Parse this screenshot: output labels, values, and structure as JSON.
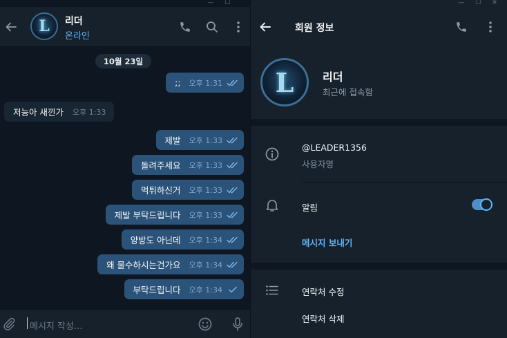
{
  "chat": {
    "peer_name": "리더",
    "peer_status": "온라인",
    "date_chip": "10월 23일",
    "messages": [
      {
        "text": ";;",
        "time": "오후 1:31",
        "dir": "out"
      },
      {
        "text": "저능아 새낀가",
        "time": "오후 1:33",
        "dir": "in"
      },
      {
        "text": "제발",
        "time": "오후 1:33",
        "dir": "out"
      },
      {
        "text": "돌려주세요",
        "time": "오후 1:33",
        "dir": "out"
      },
      {
        "text": "먹튀하신거",
        "time": "오후 1:33",
        "dir": "out"
      },
      {
        "text": "제발 부탁드립니다",
        "time": "오후 1:33",
        "dir": "out"
      },
      {
        "text": "양방도 아닌데",
        "time": "오후 1:34",
        "dir": "out"
      },
      {
        "text": "왜 물수하시는건가요",
        "time": "오후 1:34",
        "dir": "out"
      },
      {
        "text": "부탁드립니다",
        "time": "오후 1:34",
        "dir": "out"
      }
    ],
    "composer_placeholder": "메시지 작성..."
  },
  "info": {
    "title": "회원 정보",
    "name": "리더",
    "status": "최근에 접속함",
    "username": "@LEADER1356",
    "username_label": "사용자명",
    "notifications_label": "알림",
    "notifications_on": true,
    "send_message": "메시지 보내기",
    "edit_contact": "연락처 수정",
    "delete_contact": "연락처 삭제"
  },
  "colors": {
    "accent": "#5eb5f7",
    "outgoing_bubble": "#2b5278",
    "incoming_bubble": "#182533",
    "panel": "#17212b",
    "chat_bg": "#0e1621"
  },
  "icons": [
    "back-arrow-icon",
    "phone-icon",
    "search-icon",
    "more-vertical-icon",
    "info-icon",
    "bell-icon",
    "list-icon",
    "paperclip-icon",
    "emoji-icon",
    "microphone-icon",
    "double-check-icon",
    "window-minimize-icon",
    "window-maximize-icon",
    "window-close-icon"
  ]
}
